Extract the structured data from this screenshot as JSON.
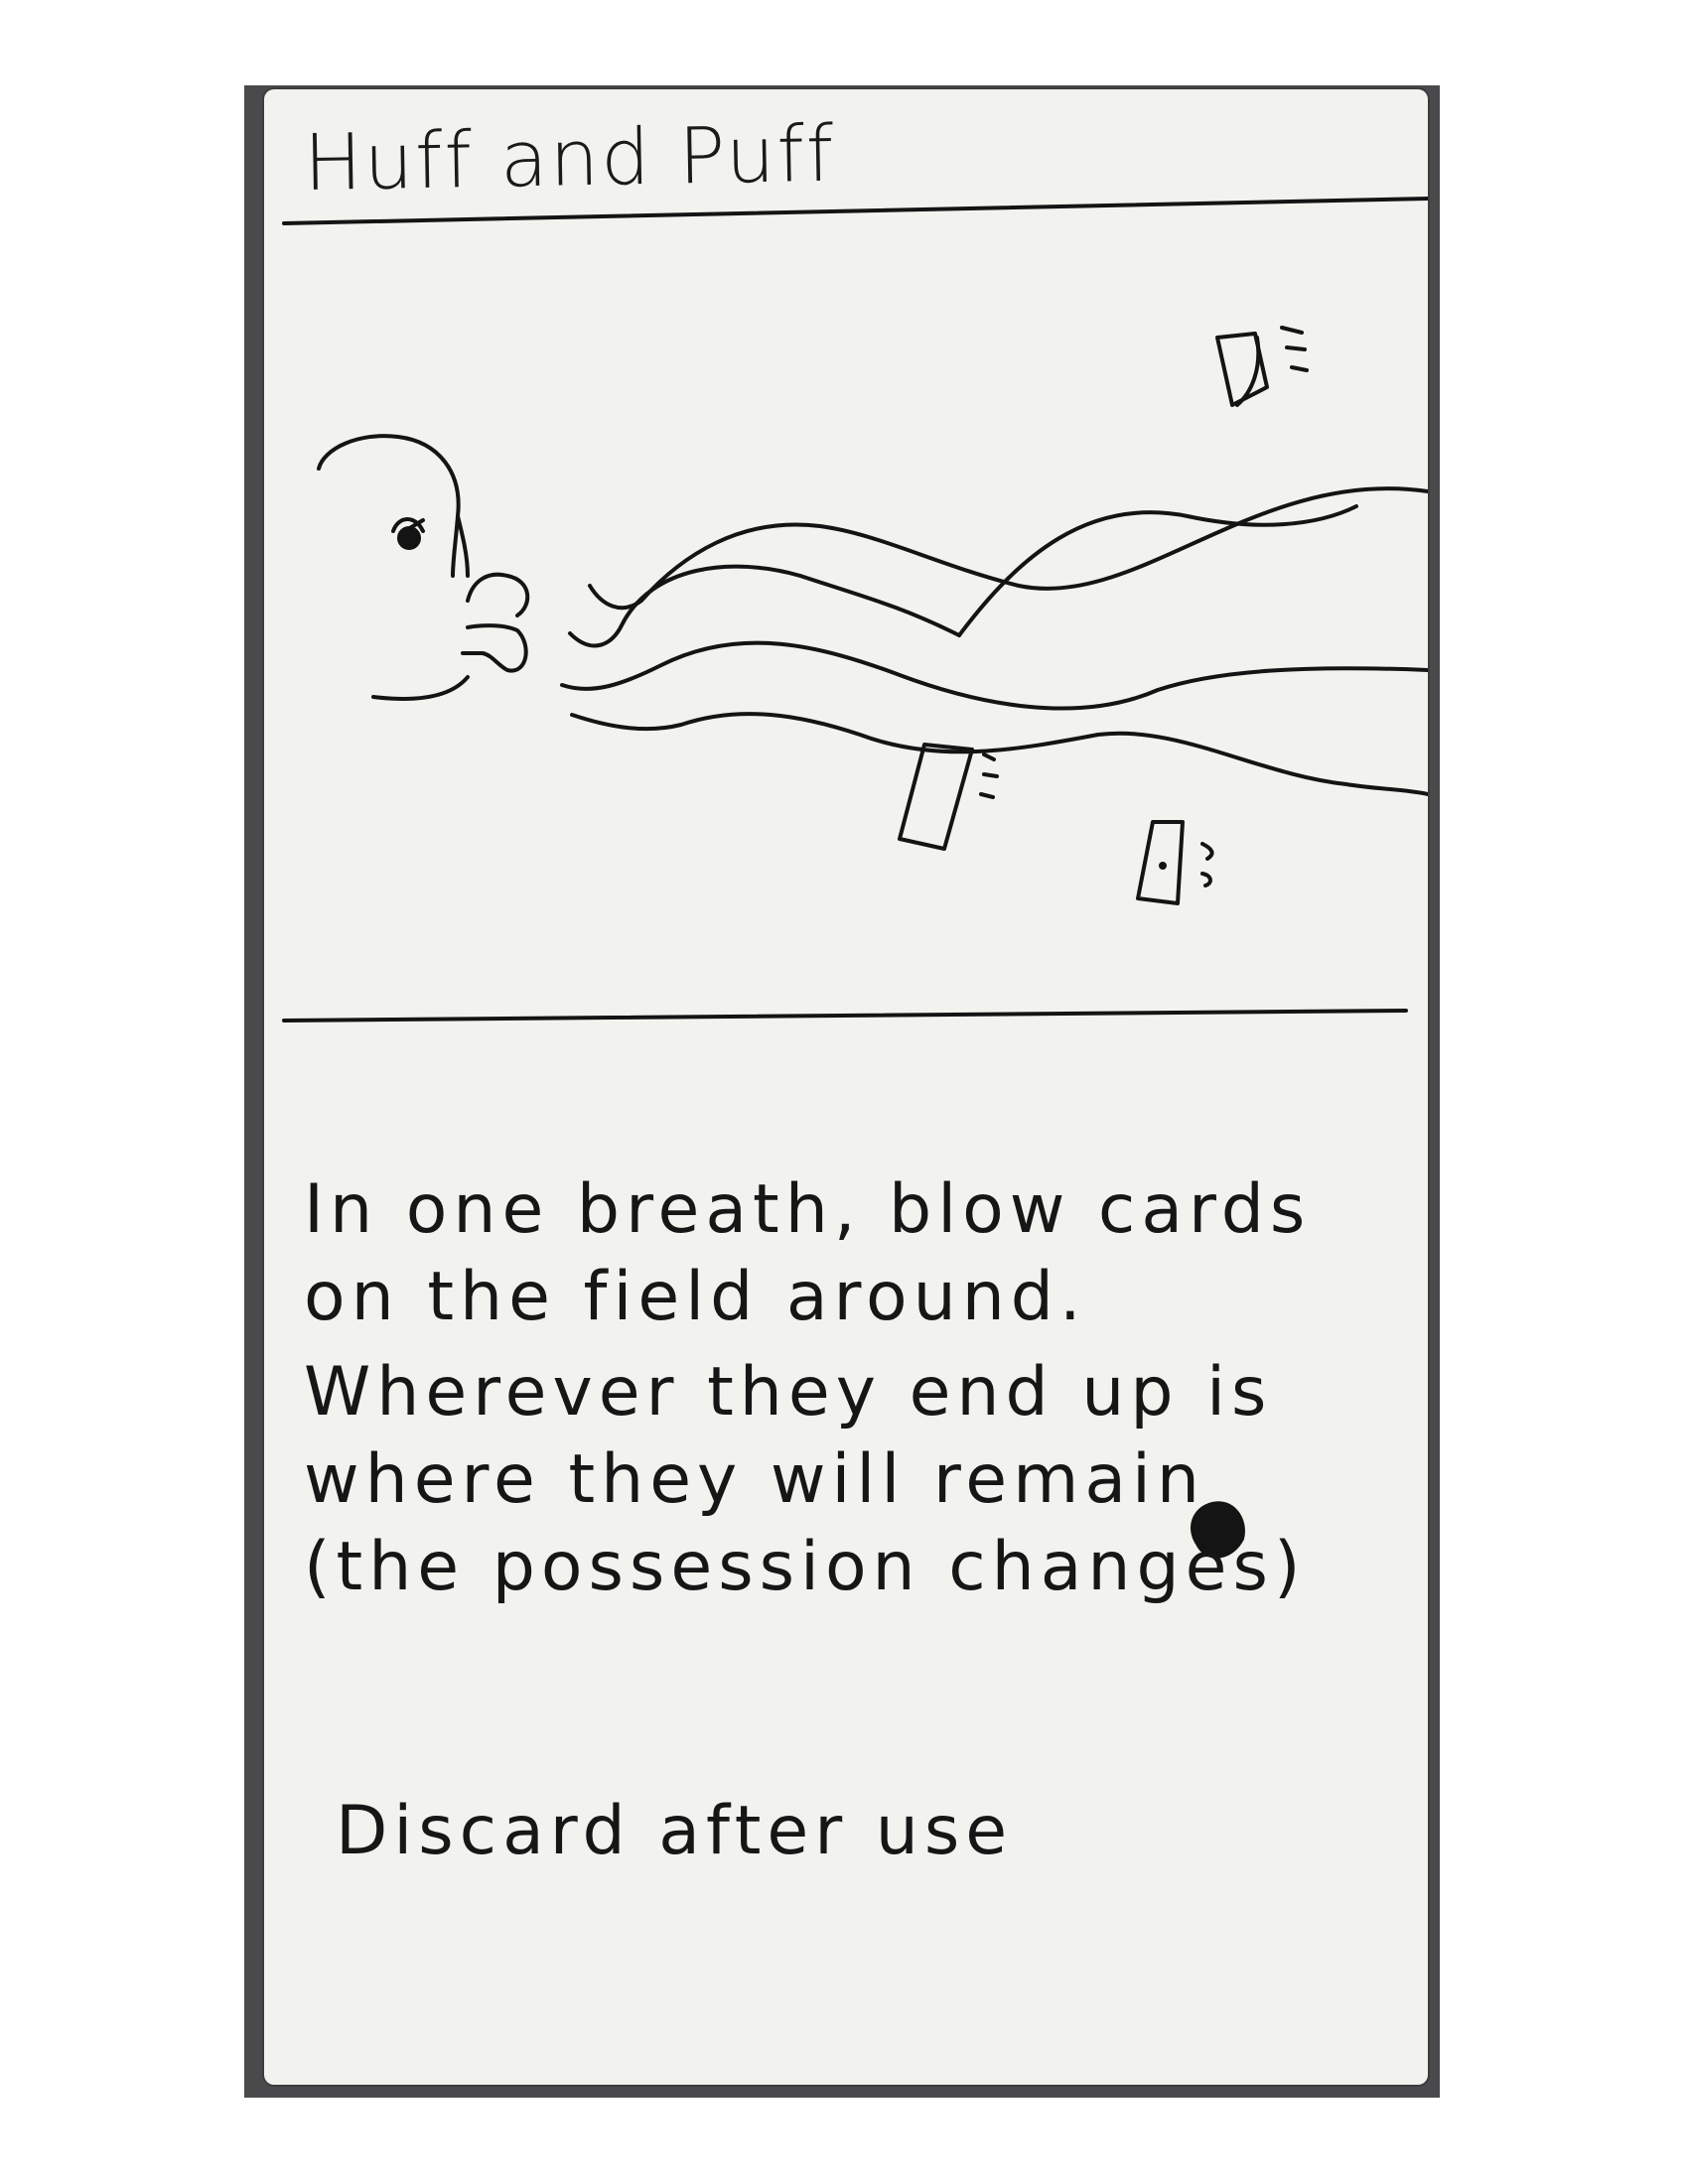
{
  "card": {
    "title": "Huff and Puff",
    "effect_paragraphs": [
      "In one breath, blow cards on the field around.",
      "Wherever they end up is where they will remain (the possession changes)"
    ],
    "footer": "Discard after use"
  },
  "colors": {
    "ink": "#161616",
    "card_paper": "#f2f2ef",
    "backdrop": "#4a4a4c"
  }
}
